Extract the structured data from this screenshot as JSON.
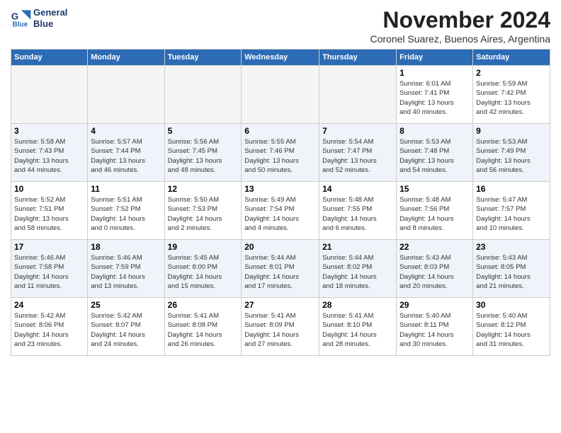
{
  "logo": {
    "line1": "General",
    "line2": "Blue"
  },
  "title": "November 2024",
  "subtitle": "Coronel Suarez, Buenos Aires, Argentina",
  "weekdays": [
    "Sunday",
    "Monday",
    "Tuesday",
    "Wednesday",
    "Thursday",
    "Friday",
    "Saturday"
  ],
  "weeks": [
    [
      {
        "day": "",
        "detail": ""
      },
      {
        "day": "",
        "detail": ""
      },
      {
        "day": "",
        "detail": ""
      },
      {
        "day": "",
        "detail": ""
      },
      {
        "day": "",
        "detail": ""
      },
      {
        "day": "1",
        "detail": "Sunrise: 6:01 AM\nSunset: 7:41 PM\nDaylight: 13 hours\nand 40 minutes."
      },
      {
        "day": "2",
        "detail": "Sunrise: 5:59 AM\nSunset: 7:42 PM\nDaylight: 13 hours\nand 42 minutes."
      }
    ],
    [
      {
        "day": "3",
        "detail": "Sunrise: 5:58 AM\nSunset: 7:43 PM\nDaylight: 13 hours\nand 44 minutes."
      },
      {
        "day": "4",
        "detail": "Sunrise: 5:57 AM\nSunset: 7:44 PM\nDaylight: 13 hours\nand 46 minutes."
      },
      {
        "day": "5",
        "detail": "Sunrise: 5:56 AM\nSunset: 7:45 PM\nDaylight: 13 hours\nand 48 minutes."
      },
      {
        "day": "6",
        "detail": "Sunrise: 5:55 AM\nSunset: 7:46 PM\nDaylight: 13 hours\nand 50 minutes."
      },
      {
        "day": "7",
        "detail": "Sunrise: 5:54 AM\nSunset: 7:47 PM\nDaylight: 13 hours\nand 52 minutes."
      },
      {
        "day": "8",
        "detail": "Sunrise: 5:53 AM\nSunset: 7:48 PM\nDaylight: 13 hours\nand 54 minutes."
      },
      {
        "day": "9",
        "detail": "Sunrise: 5:53 AM\nSunset: 7:49 PM\nDaylight: 13 hours\nand 56 minutes."
      }
    ],
    [
      {
        "day": "10",
        "detail": "Sunrise: 5:52 AM\nSunset: 7:51 PM\nDaylight: 13 hours\nand 58 minutes."
      },
      {
        "day": "11",
        "detail": "Sunrise: 5:51 AM\nSunset: 7:52 PM\nDaylight: 14 hours\nand 0 minutes."
      },
      {
        "day": "12",
        "detail": "Sunrise: 5:50 AM\nSunset: 7:53 PM\nDaylight: 14 hours\nand 2 minutes."
      },
      {
        "day": "13",
        "detail": "Sunrise: 5:49 AM\nSunset: 7:54 PM\nDaylight: 14 hours\nand 4 minutes."
      },
      {
        "day": "14",
        "detail": "Sunrise: 5:48 AM\nSunset: 7:55 PM\nDaylight: 14 hours\nand 6 minutes."
      },
      {
        "day": "15",
        "detail": "Sunrise: 5:48 AM\nSunset: 7:56 PM\nDaylight: 14 hours\nand 8 minutes."
      },
      {
        "day": "16",
        "detail": "Sunrise: 5:47 AM\nSunset: 7:57 PM\nDaylight: 14 hours\nand 10 minutes."
      }
    ],
    [
      {
        "day": "17",
        "detail": "Sunrise: 5:46 AM\nSunset: 7:58 PM\nDaylight: 14 hours\nand 11 minutes."
      },
      {
        "day": "18",
        "detail": "Sunrise: 5:46 AM\nSunset: 7:59 PM\nDaylight: 14 hours\nand 13 minutes."
      },
      {
        "day": "19",
        "detail": "Sunrise: 5:45 AM\nSunset: 8:00 PM\nDaylight: 14 hours\nand 15 minutes."
      },
      {
        "day": "20",
        "detail": "Sunrise: 5:44 AM\nSunset: 8:01 PM\nDaylight: 14 hours\nand 17 minutes."
      },
      {
        "day": "21",
        "detail": "Sunrise: 5:44 AM\nSunset: 8:02 PM\nDaylight: 14 hours\nand 18 minutes."
      },
      {
        "day": "22",
        "detail": "Sunrise: 5:43 AM\nSunset: 8:03 PM\nDaylight: 14 hours\nand 20 minutes."
      },
      {
        "day": "23",
        "detail": "Sunrise: 5:43 AM\nSunset: 8:05 PM\nDaylight: 14 hours\nand 21 minutes."
      }
    ],
    [
      {
        "day": "24",
        "detail": "Sunrise: 5:42 AM\nSunset: 8:06 PM\nDaylight: 14 hours\nand 23 minutes."
      },
      {
        "day": "25",
        "detail": "Sunrise: 5:42 AM\nSunset: 8:07 PM\nDaylight: 14 hours\nand 24 minutes."
      },
      {
        "day": "26",
        "detail": "Sunrise: 5:41 AM\nSunset: 8:08 PM\nDaylight: 14 hours\nand 26 minutes."
      },
      {
        "day": "27",
        "detail": "Sunrise: 5:41 AM\nSunset: 8:09 PM\nDaylight: 14 hours\nand 27 minutes."
      },
      {
        "day": "28",
        "detail": "Sunrise: 5:41 AM\nSunset: 8:10 PM\nDaylight: 14 hours\nand 28 minutes."
      },
      {
        "day": "29",
        "detail": "Sunrise: 5:40 AM\nSunset: 8:11 PM\nDaylight: 14 hours\nand 30 minutes."
      },
      {
        "day": "30",
        "detail": "Sunrise: 5:40 AM\nSunset: 8:12 PM\nDaylight: 14 hours\nand 31 minutes."
      }
    ]
  ]
}
